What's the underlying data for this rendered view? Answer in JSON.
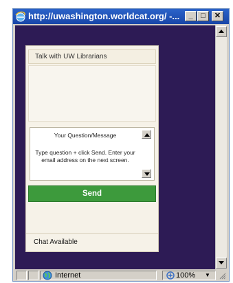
{
  "window": {
    "title": "http://uwashington.worldcat.org/ -...",
    "buttons": {
      "minimize": "_",
      "maximize": "□",
      "close": "✕"
    }
  },
  "chat": {
    "header": "Talk with UW Librarians",
    "message_box_title": "Your Question/Message",
    "message_box_hint": "Type question + click Send. Enter your email address on the next screen.",
    "send_label": "Send",
    "status": "Chat Available"
  },
  "statusbar": {
    "zone": "Internet",
    "zoom": "100%"
  },
  "colors": {
    "page_background": "#2d1b55",
    "send_button": "#3d9a3c",
    "titlebar": "#1846a8"
  },
  "icons": {
    "browser": "ie-icon",
    "zone": "globe-icon",
    "zoom": "zoom-icon"
  }
}
